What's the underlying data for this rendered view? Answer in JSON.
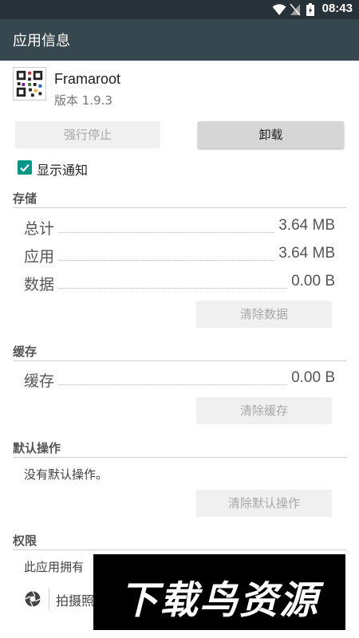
{
  "status_bar": {
    "time": "08:43"
  },
  "toolbar": {
    "title": "应用信息"
  },
  "app": {
    "name": "Framaroot",
    "version": "版本 1.9.3"
  },
  "buttons": {
    "force_stop": "强行停止",
    "uninstall": "卸载"
  },
  "notifications": {
    "label": "显示通知",
    "checked": true
  },
  "storage": {
    "header": "存储",
    "rows": [
      {
        "label": "总计",
        "value": "3.64 MB"
      },
      {
        "label": "应用",
        "value": "3.64 MB"
      },
      {
        "label": "数据",
        "value": "0.00 B"
      }
    ],
    "clear_button": "清除数据"
  },
  "cache": {
    "header": "缓存",
    "rows": [
      {
        "label": "缓存",
        "value": "0.00 B"
      }
    ],
    "clear_button": "清除缓存"
  },
  "defaults": {
    "header": "默认操作",
    "text": "没有默认操作。",
    "clear_button": "清除默认操作"
  },
  "permissions": {
    "header": "权限",
    "text": "此应用拥有",
    "item": "拍摄照"
  },
  "watermark": {
    "text": "下载鸟资源"
  },
  "colors": {
    "toolbar": "#37474f",
    "statusbar": "#263238",
    "accent": "#009688"
  }
}
